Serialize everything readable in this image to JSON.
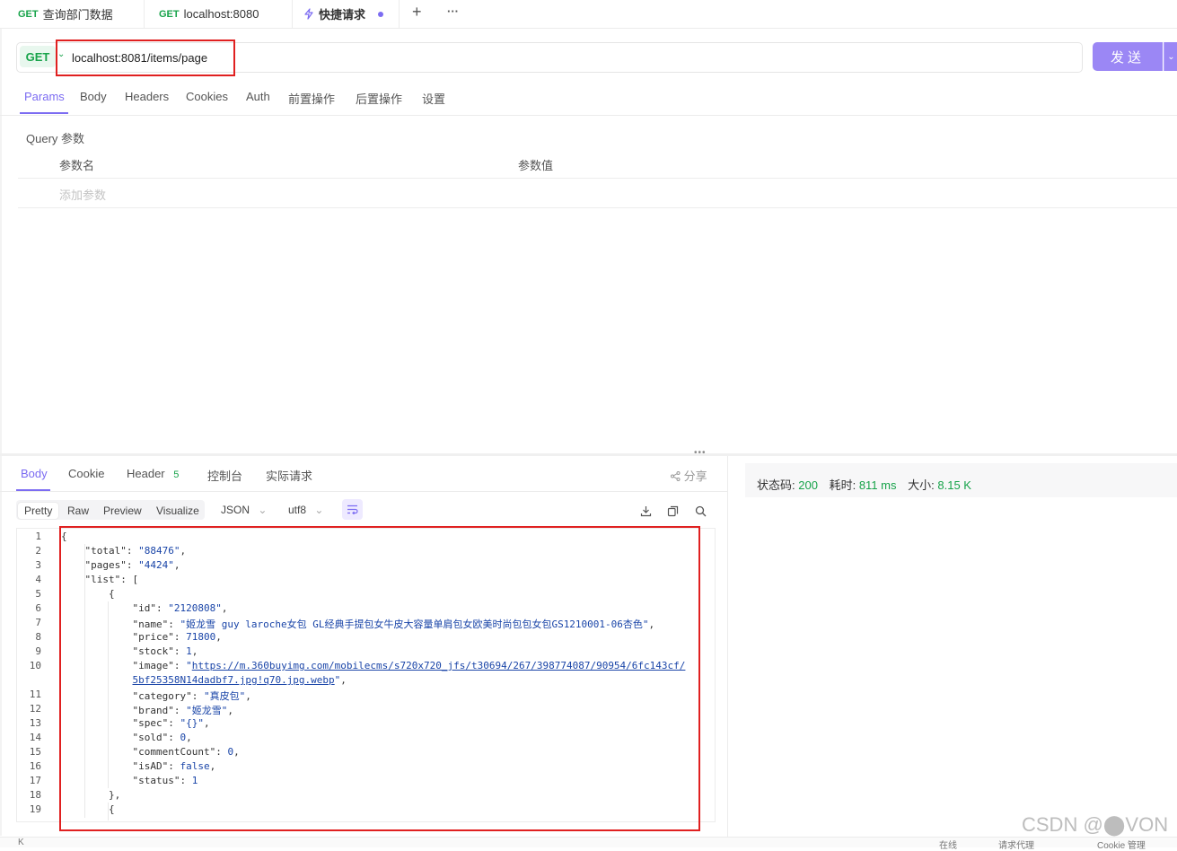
{
  "tabs": [
    {
      "method": "GET",
      "label": "查询部门数据"
    },
    {
      "method": "GET",
      "label": "localhost:8080"
    },
    {
      "label": "快捷请求",
      "active": true
    }
  ],
  "tab_actions": {
    "add": "+",
    "more": "···"
  },
  "request": {
    "method": "GET",
    "url": "localhost:8081/items/page",
    "send_label": "发送"
  },
  "request_tabs": [
    "Params",
    "Body",
    "Headers",
    "Cookies",
    "Auth",
    "前置操作",
    "后置操作",
    "设置"
  ],
  "params": {
    "section_title": "Query 参数",
    "col_name": "参数名",
    "col_value": "参数值",
    "add_placeholder": "添加参数"
  },
  "response_tabs": [
    {
      "label": "Body",
      "active": true
    },
    {
      "label": "Cookie"
    },
    {
      "label": "Header",
      "badge": "5"
    },
    {
      "label": "控制台"
    },
    {
      "label": "实际请求"
    }
  ],
  "share_label": "分享",
  "status": {
    "code_label": "状态码:",
    "code": "200",
    "time_label": "耗时:",
    "time": "811 ms",
    "size_label": "大小:",
    "size": "8.15 K"
  },
  "view_modes": [
    "Pretty",
    "Raw",
    "Preview",
    "Visualize"
  ],
  "format": "JSON",
  "encoding": "utf8",
  "code_lines": [
    {
      "n": "1",
      "indent": 0,
      "parts": [
        [
          "k",
          "{"
        ]
      ]
    },
    {
      "n": "2",
      "indent": 1,
      "parts": [
        [
          "k",
          "\"total\": "
        ],
        [
          "s",
          "\"88476\""
        ],
        [
          "k",
          ","
        ]
      ]
    },
    {
      "n": "3",
      "indent": 1,
      "parts": [
        [
          "k",
          "\"pages\": "
        ],
        [
          "s",
          "\"4424\""
        ],
        [
          "k",
          ","
        ]
      ]
    },
    {
      "n": "4",
      "indent": 1,
      "parts": [
        [
          "k",
          "\"list\": ["
        ]
      ]
    },
    {
      "n": "5",
      "indent": 2,
      "parts": [
        [
          "k",
          "{"
        ]
      ]
    },
    {
      "n": "6",
      "indent": 3,
      "parts": [
        [
          "k",
          "\"id\": "
        ],
        [
          "s",
          "\"2120808\""
        ],
        [
          "k",
          ","
        ]
      ]
    },
    {
      "n": "7",
      "indent": 3,
      "parts": [
        [
          "k",
          "\"name\": "
        ],
        [
          "s",
          "\"姬龙雪 guy laroche女包 GL经典手提包女牛皮大容量单肩包女欧美时尚包包女包GS1210001-06杏色\""
        ],
        [
          "k",
          ","
        ]
      ]
    },
    {
      "n": "8",
      "indent": 3,
      "parts": [
        [
          "k",
          "\"price\": "
        ],
        [
          "n",
          "71800"
        ],
        [
          "k",
          ","
        ]
      ]
    },
    {
      "n": "9",
      "indent": 3,
      "parts": [
        [
          "k",
          "\"stock\": "
        ],
        [
          "n",
          "1"
        ],
        [
          "k",
          ","
        ]
      ]
    },
    {
      "n": "10",
      "indent": 3,
      "parts": [
        [
          "k",
          "\"image\": "
        ],
        [
          "s",
          "\""
        ],
        [
          "u",
          "https://m.360buyimg.com/mobilecms/s720x720_jfs/t30694/267/398774087/90954/6fc143cf/"
        ]
      ]
    },
    {
      "n": "",
      "indent": 3,
      "parts": [
        [
          "u",
          "5bf25358N14dadbf7.jpg!q70.jpg.webp"
        ],
        [
          "s",
          "\""
        ],
        [
          "k",
          ","
        ]
      ]
    },
    {
      "n": "11",
      "indent": 3,
      "parts": [
        [
          "k",
          "\"category\": "
        ],
        [
          "s",
          "\"真皮包\""
        ],
        [
          "k",
          ","
        ]
      ]
    },
    {
      "n": "12",
      "indent": 3,
      "parts": [
        [
          "k",
          "\"brand\": "
        ],
        [
          "s",
          "\"姬龙雪\""
        ],
        [
          "k",
          ","
        ]
      ]
    },
    {
      "n": "13",
      "indent": 3,
      "parts": [
        [
          "k",
          "\"spec\": "
        ],
        [
          "s",
          "\"{}\""
        ],
        [
          "k",
          ","
        ]
      ]
    },
    {
      "n": "14",
      "indent": 3,
      "parts": [
        [
          "k",
          "\"sold\": "
        ],
        [
          "n",
          "0"
        ],
        [
          "k",
          ","
        ]
      ]
    },
    {
      "n": "15",
      "indent": 3,
      "parts": [
        [
          "k",
          "\"commentCount\": "
        ],
        [
          "n",
          "0"
        ],
        [
          "k",
          ","
        ]
      ]
    },
    {
      "n": "16",
      "indent": 3,
      "parts": [
        [
          "k",
          "\"isAD\": "
        ],
        [
          "b",
          "false"
        ],
        [
          "k",
          ","
        ]
      ]
    },
    {
      "n": "17",
      "indent": 3,
      "parts": [
        [
          "k",
          "\"status\": "
        ],
        [
          "n",
          "1"
        ]
      ]
    },
    {
      "n": "18",
      "indent": 2,
      "parts": [
        [
          "k",
          "},"
        ]
      ]
    },
    {
      "n": "19",
      "indent": 2,
      "parts": [
        [
          "k",
          "{"
        ]
      ]
    }
  ],
  "watermark": "CSDN @⬤VON",
  "footer": {
    "left": "K",
    "online": "在线",
    "agent": "请求代理",
    "cookie": "Cookie 管理"
  }
}
